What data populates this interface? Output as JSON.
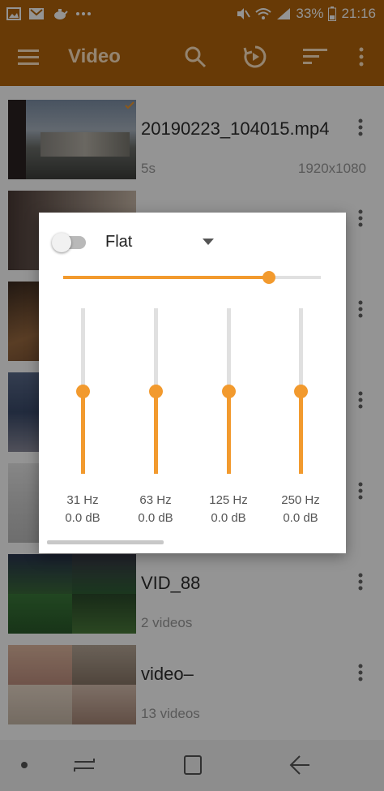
{
  "status_bar": {
    "battery_text": "33%",
    "time": "21:16",
    "left_icons": [
      "gallery-icon",
      "email-icon",
      "teapot-icon",
      "more-dots"
    ],
    "right_icons": [
      "mute-icon",
      "wifi-icon",
      "signal-icon",
      "battery-icon"
    ]
  },
  "app_bar": {
    "title": "Video",
    "actions": [
      "search-icon",
      "resume-icon",
      "sort-icon",
      "overflow-icon"
    ]
  },
  "videos": [
    {
      "title": "20190223_104015.mp4",
      "subtitle": "5s",
      "resolution": "1920x1080"
    },
    {
      "title": "",
      "subtitle": "",
      "resolution": ""
    },
    {
      "title": "",
      "subtitle": "",
      "resolution": ""
    },
    {
      "title": "",
      "subtitle": "",
      "resolution": ""
    },
    {
      "title": "",
      "subtitle": "",
      "resolution": ""
    },
    {
      "title": "VID_88",
      "subtitle": "2 videos",
      "resolution": ""
    },
    {
      "title": "video–",
      "subtitle": "13 videos",
      "resolution": ""
    }
  ],
  "equalizer": {
    "enabled": false,
    "preset": "Flat",
    "preamp_level": 0.8,
    "bands": [
      {
        "freq": "31 Hz",
        "gain": "0.0 dB",
        "level": 0.5
      },
      {
        "freq": "63 Hz",
        "gain": "0.0 dB",
        "level": 0.5
      },
      {
        "freq": "125 Hz",
        "gain": "0.0 dB",
        "level": 0.5
      },
      {
        "freq": "250 Hz",
        "gain": "0.0 dB",
        "level": 0.5
      }
    ]
  },
  "nav_bar": {
    "buttons": [
      "recents-icon",
      "home-icon",
      "back-icon"
    ]
  },
  "colors": {
    "accent": "#f29a2e",
    "toolbar": "#b3650b"
  }
}
